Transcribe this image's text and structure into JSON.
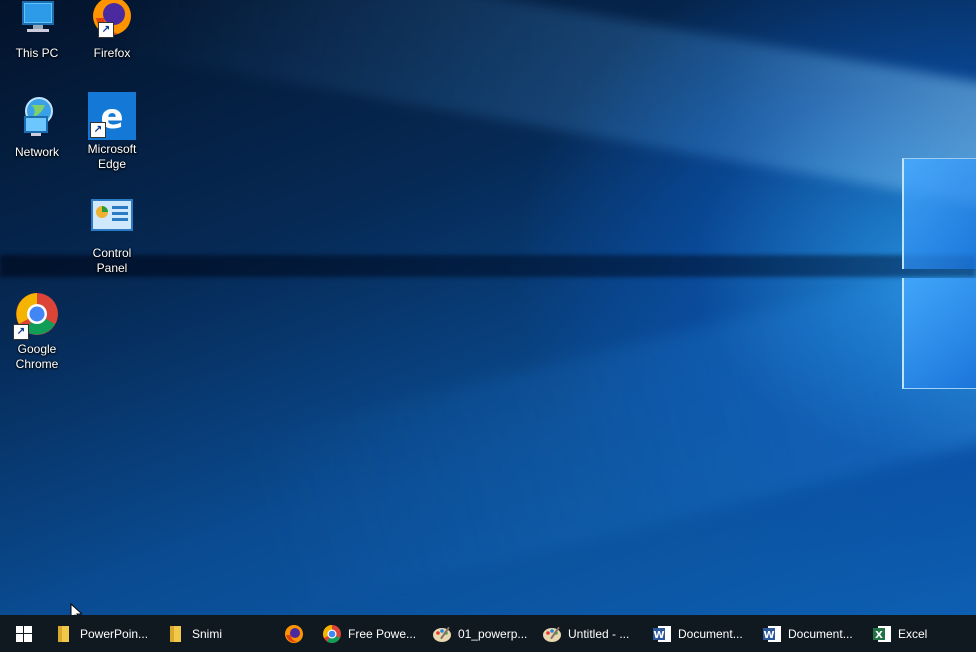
{
  "desktop_icons": {
    "this_pc": "This PC",
    "firefox": "Firefox",
    "network": "Network",
    "edge": "Microsoft\nEdge",
    "control_panel": "Control\nPanel",
    "chrome": "Google\nChrome"
  },
  "taskbar": {
    "items": [
      {
        "label": "PowerPoin...",
        "icon": "folder-icon"
      },
      {
        "label": "Snimi",
        "icon": "folder-icon"
      },
      {
        "label": "",
        "icon": "firefox-icon"
      },
      {
        "label": "Free Powe...",
        "icon": "chrome-icon"
      },
      {
        "label": "01_powerp...",
        "icon": "paint-icon"
      },
      {
        "label": "Untitled - ...",
        "icon": "paint-icon"
      },
      {
        "label": "Document...",
        "icon": "word-icon"
      },
      {
        "label": "Document...",
        "icon": "word-icon"
      },
      {
        "label": "Excel",
        "icon": "excel-icon"
      }
    ]
  },
  "colors": {
    "taskbar_bg": "#101820",
    "word_blue": "#2b579a",
    "excel_green": "#217346",
    "folder_yellow": "#f2c84b"
  }
}
